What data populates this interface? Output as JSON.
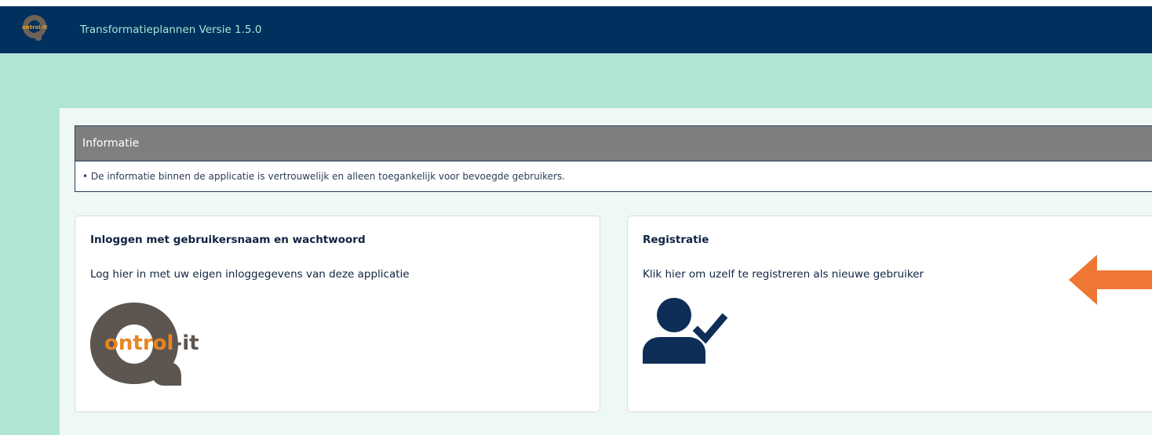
{
  "header": {
    "title": "Transformatieplannen Versie 1.5.0",
    "logo_text": "ontrol-it"
  },
  "info": {
    "heading": "Informatie",
    "message": "• De informatie binnen de applicatie is vertrouwelijk en alleen toegankelijk voor bevoegde gebruikers."
  },
  "login_card": {
    "title": "Inloggen met gebruikersnaam en wachtwoord",
    "text": "Log hier in met uw eigen inloggegevens van deze applicatie",
    "logo_text_orange": "ntrol",
    "logo_text_dark": "-it",
    "logo_text_lead": "o"
  },
  "register_card": {
    "title": "Registratie",
    "text": "Klik hier om uzelf te registreren als nieuwe gebruiker"
  },
  "colors": {
    "navbar": "#00305e",
    "accent_teal": "#b0e5d5",
    "arrow": "#ee7733",
    "icon_navy": "#0e2e57"
  }
}
